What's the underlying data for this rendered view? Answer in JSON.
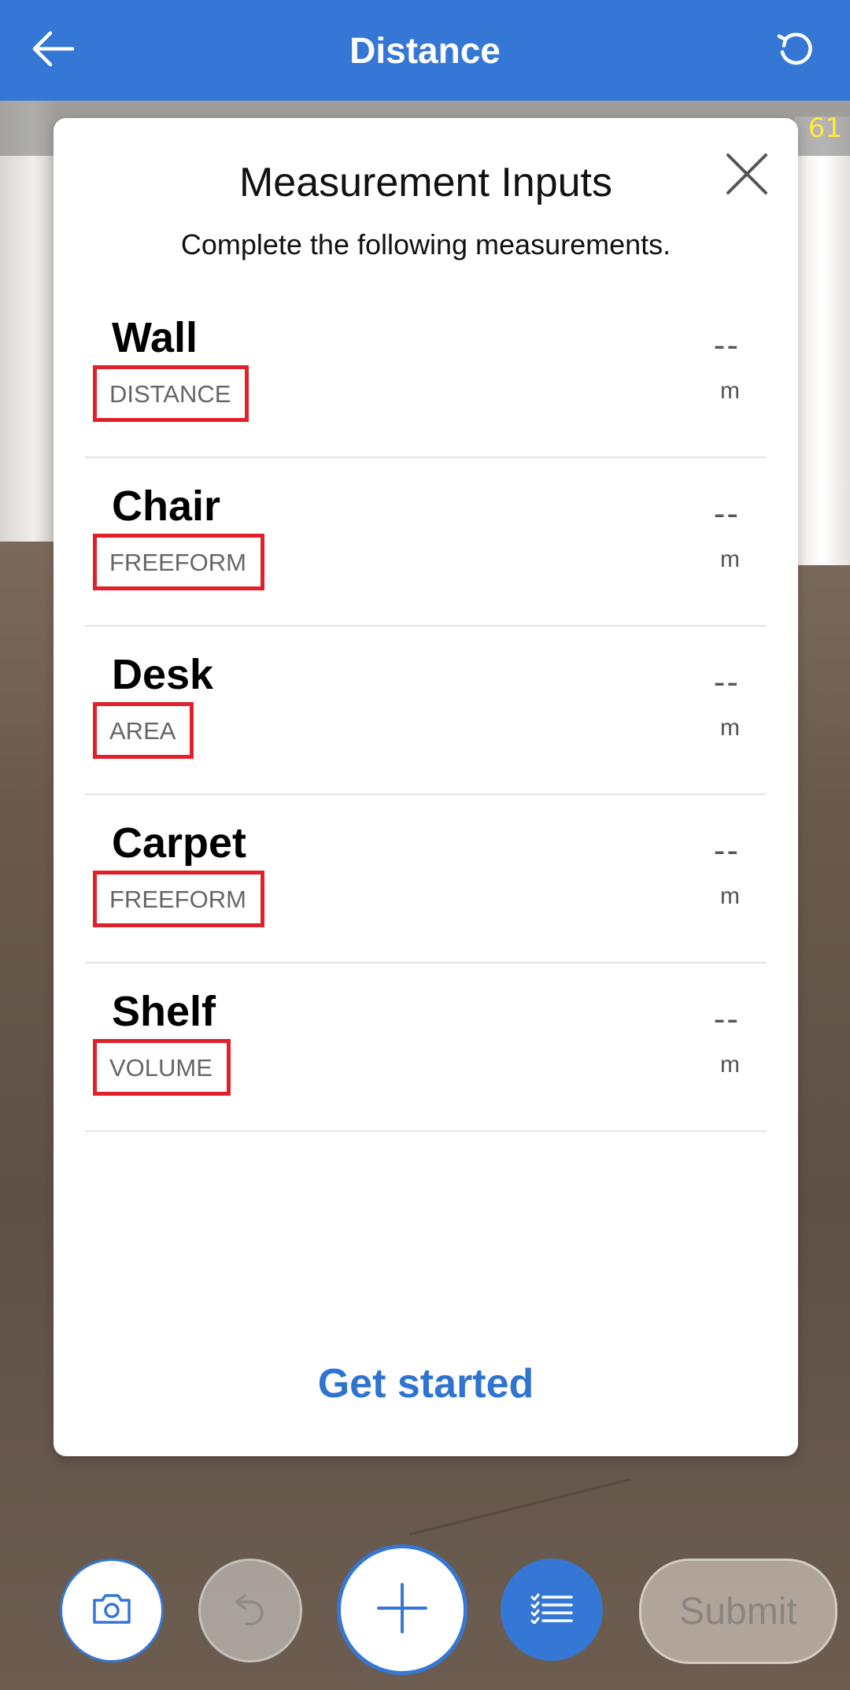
{
  "header": {
    "title": "Distance"
  },
  "overlay": {
    "debug_text": ": 61"
  },
  "modal": {
    "title": "Measurement Inputs",
    "subtitle": "Complete the following measurements.",
    "items": [
      {
        "name": "Wall",
        "type": "DISTANCE",
        "value": "--",
        "unit": "m"
      },
      {
        "name": "Chair",
        "type": "FREEFORM",
        "value": "--",
        "unit": "m"
      },
      {
        "name": "Desk",
        "type": "AREA",
        "value": "--",
        "unit": "m"
      },
      {
        "name": "Carpet",
        "type": "FREEFORM",
        "value": "--",
        "unit": "m"
      },
      {
        "name": "Shelf",
        "type": "VOLUME",
        "value": "--",
        "unit": "m"
      }
    ],
    "action_label": "Get started"
  },
  "toolbar": {
    "submit_label": "Submit"
  },
  "colors": {
    "accent": "#3577d4",
    "highlight_box": "#e0202a",
    "debug_text": "#ffea3a"
  },
  "icons": [
    "back-arrow-icon",
    "refresh-icon",
    "close-icon",
    "camera-icon",
    "undo-icon",
    "plus-icon",
    "checklist-icon"
  ]
}
